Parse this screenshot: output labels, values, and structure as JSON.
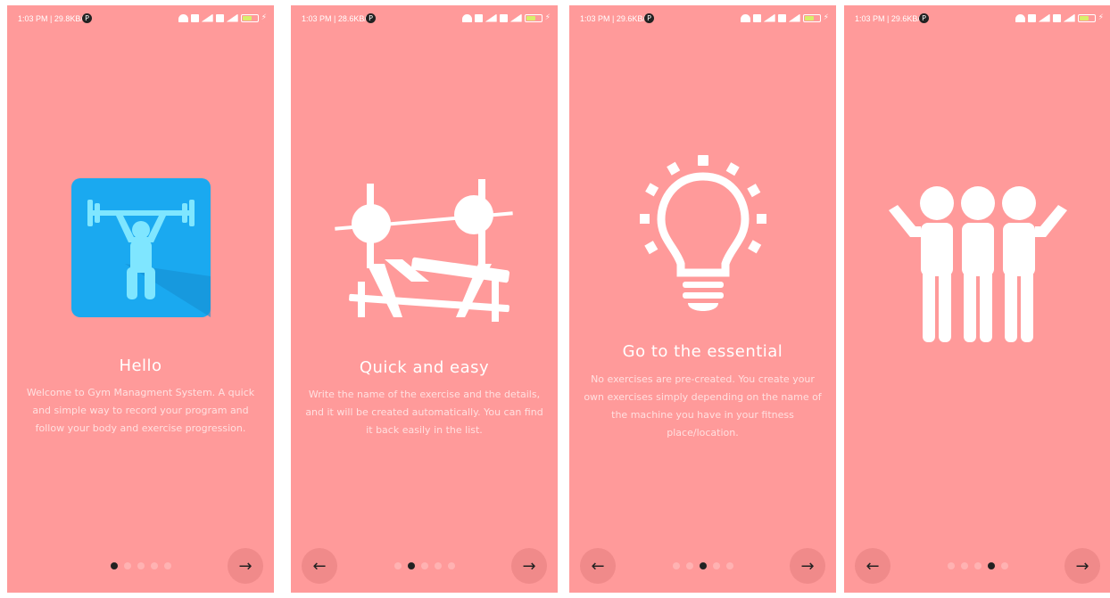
{
  "status": {
    "time": "1:03 PM",
    "screen1_speed": "29.8KB/s",
    "screen2_speed": "28.6KB/s",
    "screen3_speed": "29.6KB/s",
    "screen4_speed": "29.6KB/s",
    "avatar_initial": "P"
  },
  "screens": [
    {
      "title": "Hello",
      "description": "Welcome to Gym Managment System. A quick and simple way to record your program and follow your body and exercise progression.",
      "active_dot": 1
    },
    {
      "title": "Quick and easy",
      "description": "Write the name of the exercise and the details, and it will be created automatically. You can find it back easily in the list.",
      "active_dot": 2
    },
    {
      "title": "Go to the essential",
      "description": "No exercises are pre-created. You create your own exercises simply depending on the name of the machine you have in your fitness place/location.",
      "active_dot": 3
    },
    {
      "title": "",
      "description": "",
      "active_dot": 4
    }
  ],
  "nav": {
    "prev_glyph": "←",
    "next_glyph": "→"
  },
  "colors": {
    "background": "#ff9a9a",
    "app_icon": "#1aa9f0",
    "figure": "#7fe6ff",
    "dot_active": "#222222",
    "dot_inactive": "#ffb2b2"
  }
}
